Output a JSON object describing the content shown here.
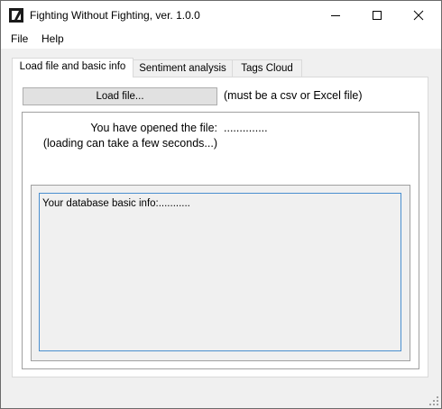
{
  "window": {
    "title": "Fighting Without Fighting, ver. 1.0.0",
    "app_icon": "app-logo-icon",
    "controls": [
      "minimize-icon",
      "maximize-icon",
      "close-icon"
    ]
  },
  "menu": {
    "items": [
      {
        "label": "File"
      },
      {
        "label": "Help"
      }
    ]
  },
  "tabs": [
    {
      "label": "Load file and basic info",
      "active": true
    },
    {
      "label": "Sentiment analysis",
      "active": false
    },
    {
      "label": "Tags Cloud",
      "active": false
    }
  ],
  "load": {
    "button_label": "Load file...",
    "hint": "(must be a csv or Excel file)"
  },
  "file_info": {
    "opened_label": "You have opened the file:",
    "opened_value": "..............",
    "loading_note": "(loading can take a few seconds...)"
  },
  "database": {
    "basic_info": "Your database basic info:..........."
  },
  "colors": {
    "window_bg": "#f0f0f0",
    "panel_bg": "#ffffff",
    "focus_border": "#4a8fcf",
    "button_bg": "#e1e1e1"
  }
}
